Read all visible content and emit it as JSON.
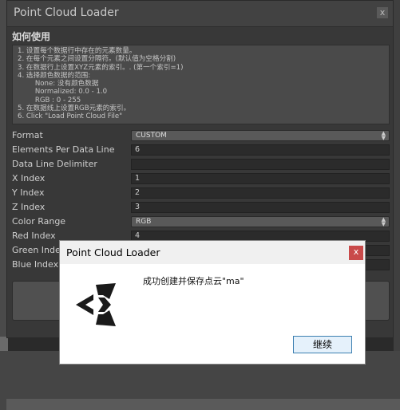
{
  "window": {
    "title": "Point Cloud Loader",
    "close_label": "x"
  },
  "section": {
    "title": "如何使用"
  },
  "help_lines": [
    "1. 设置每个数据行中存在的元素数量。",
    "2. 在每个元素之间设置分隔符。(默认值为空格分割)",
    "3. 在数据行上设置XYZ元素的索引。. (第一个索引=1)",
    "4. 选择颜色数据的范围:",
    "        None: 没有颜色数据",
    "        Normalized: 0.0 - 1.0",
    "        RGB : 0 - 255",
    "5. 在数据线上设置RGB元素的索引。",
    "6. Click \"Load Point Cloud File\""
  ],
  "fields": [
    {
      "label": "Format",
      "value": "CUSTOM",
      "type": "select"
    },
    {
      "label": "Elements Per Data Line",
      "value": "6",
      "type": "text"
    },
    {
      "label": "Data Line Delimiter",
      "value": "",
      "type": "text"
    },
    {
      "label": "X Index",
      "value": "1",
      "type": "text"
    },
    {
      "label": "Y Index",
      "value": "2",
      "type": "text"
    },
    {
      "label": "Z Index",
      "value": "3",
      "type": "text"
    },
    {
      "label": "Color Range",
      "value": "RGB",
      "type": "select"
    },
    {
      "label": "Red Index",
      "value": "4",
      "type": "text"
    },
    {
      "label": "Green Index",
      "value": "",
      "type": "text"
    },
    {
      "label": "Blue Index",
      "value": "",
      "type": "text"
    }
  ],
  "dialog": {
    "title": "Point Cloud Loader",
    "close_label": "x",
    "message": "成功创建并保存点云\"ma\"",
    "ok_label": "继续",
    "icon": "unity-logo-icon"
  },
  "icons": {
    "select_arrows": "⬍"
  }
}
